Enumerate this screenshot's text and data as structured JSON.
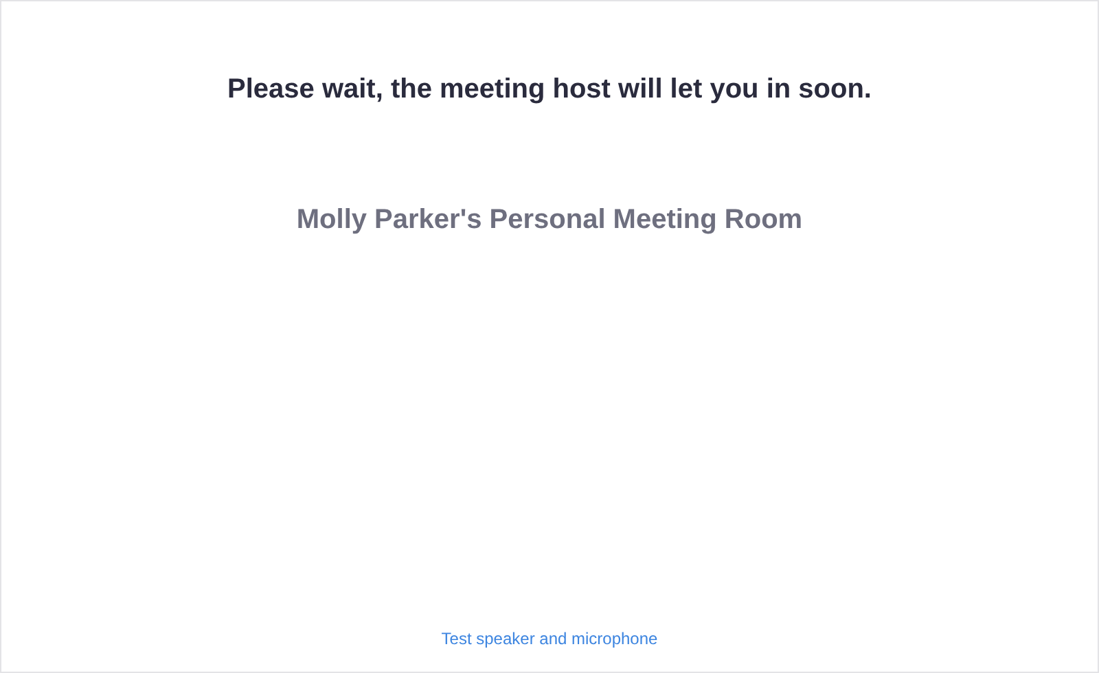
{
  "message": "Please wait, the meeting host will let you in soon.",
  "meeting_name": "Molly Parker's Personal Meeting Room",
  "test_link": "Test speaker and microphone"
}
